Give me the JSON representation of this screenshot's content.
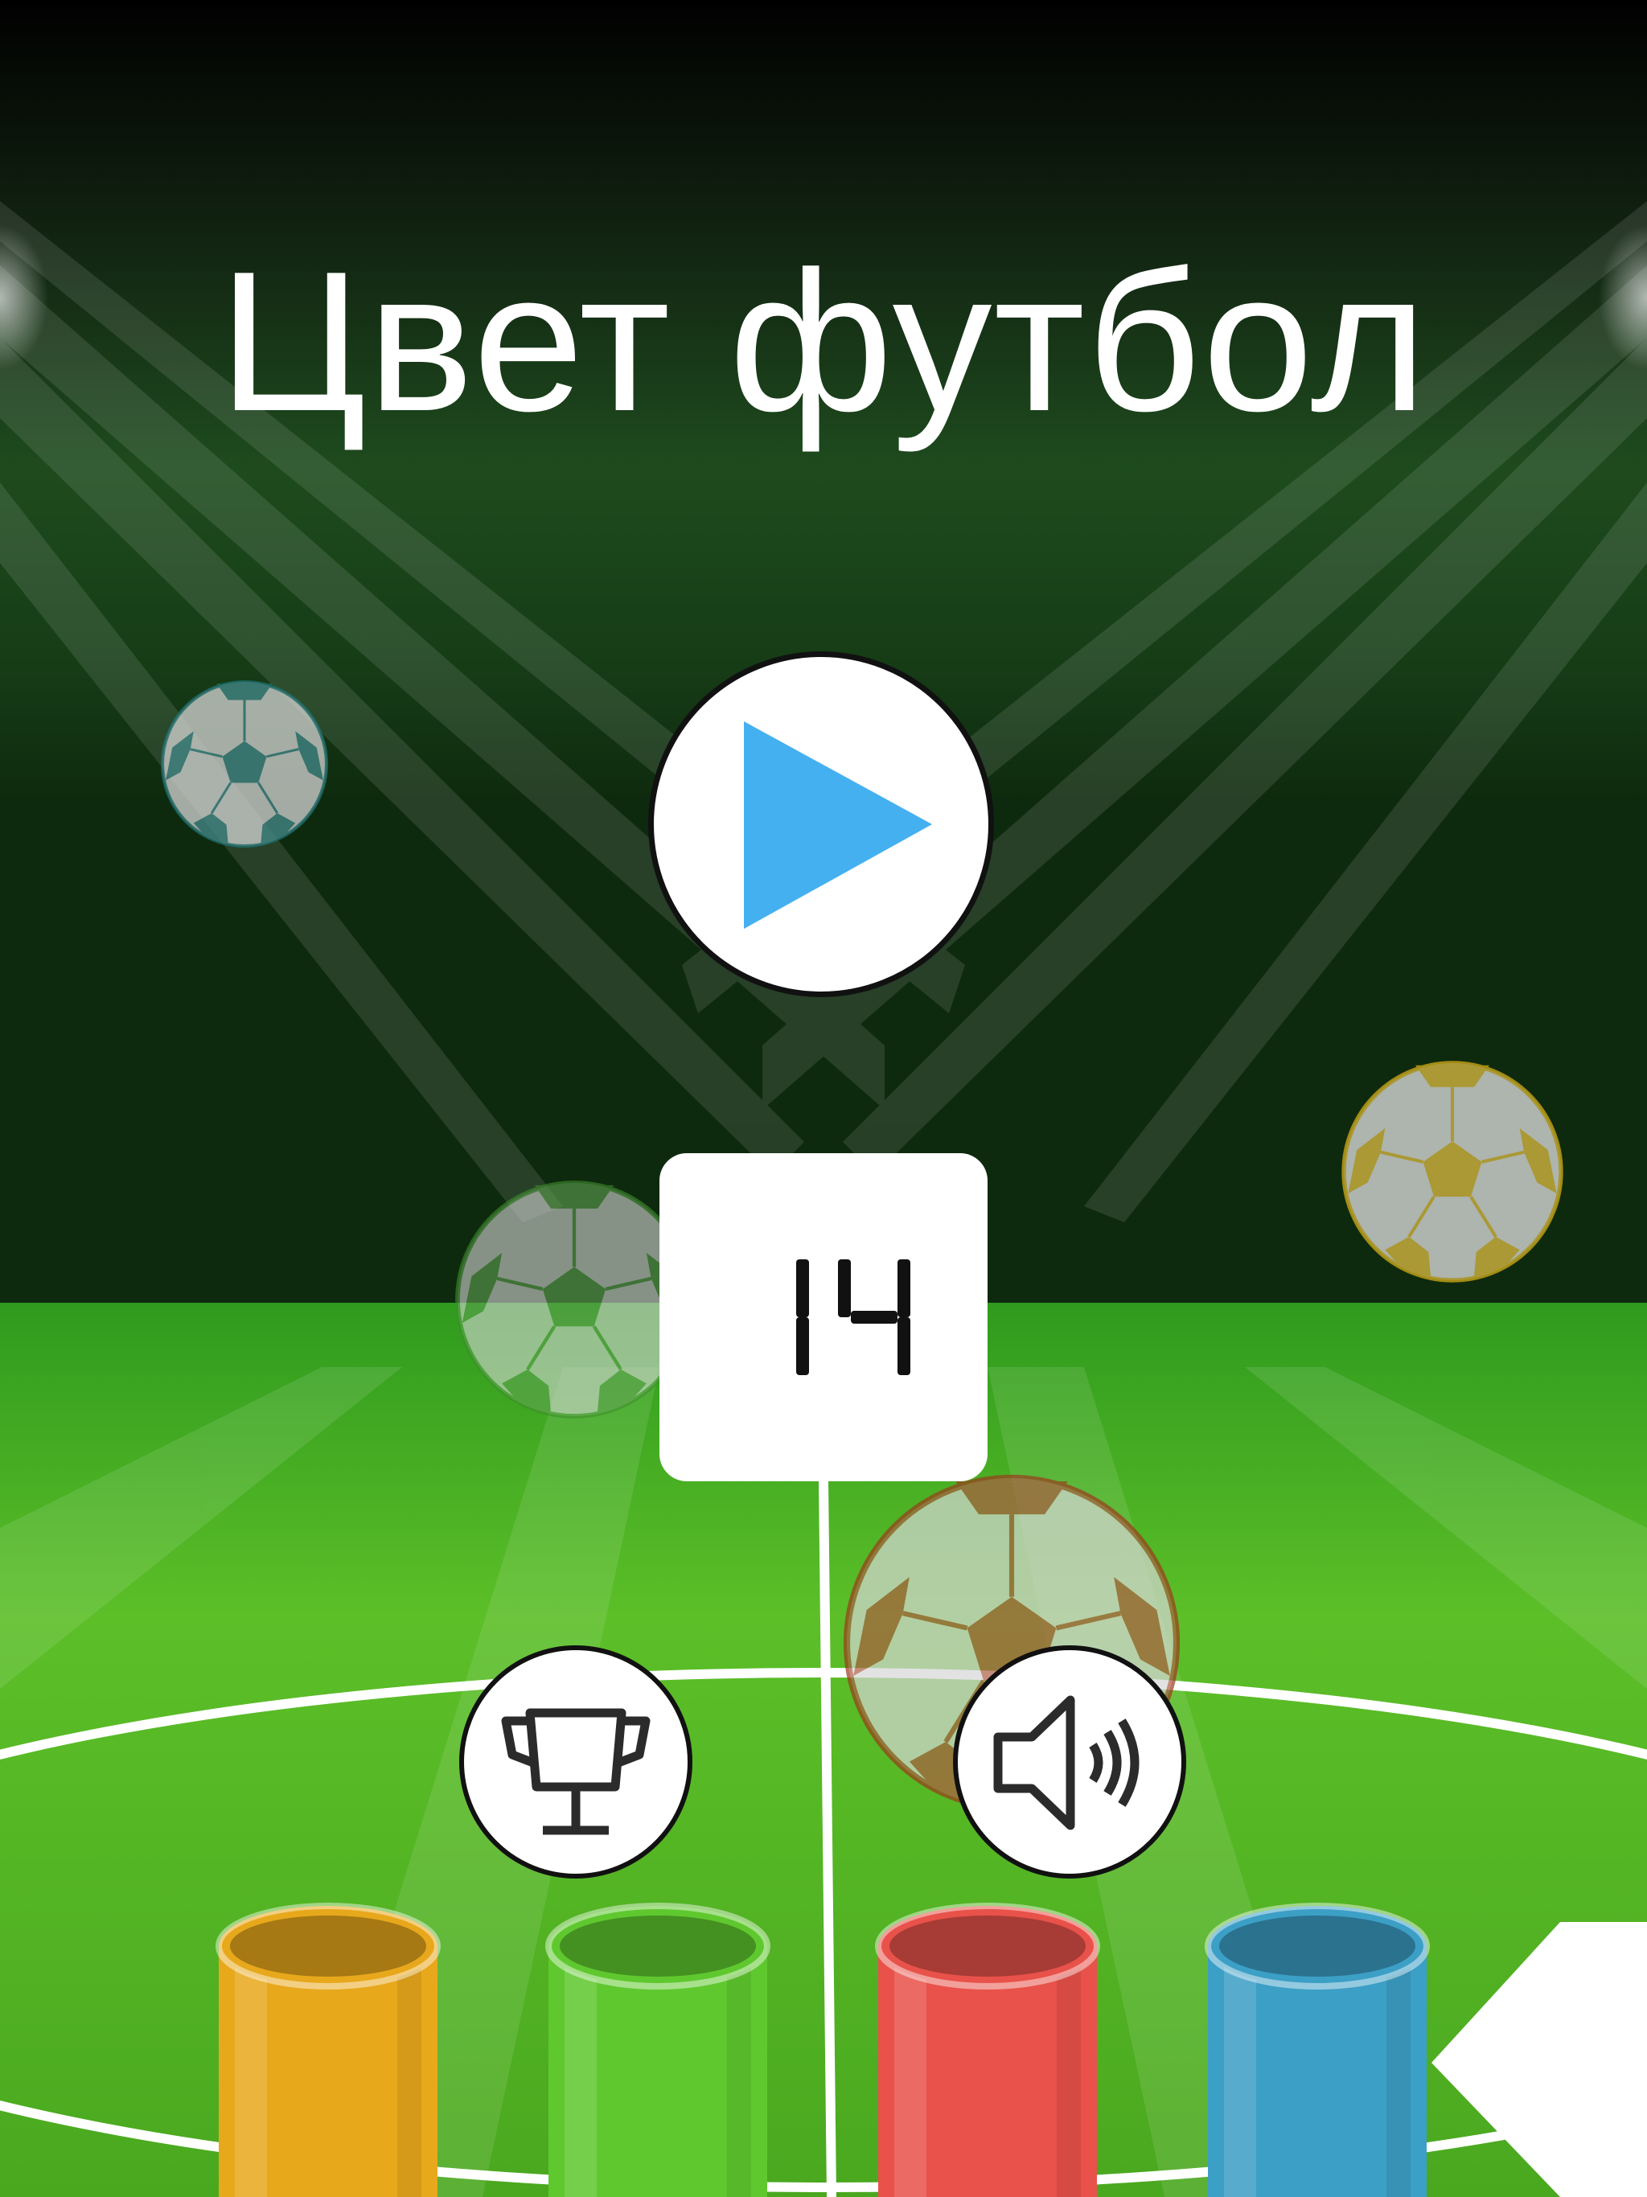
{
  "game": {
    "title": "Цвет футбол",
    "best_score": "14"
  },
  "buttons": {
    "play_icon": "play-icon",
    "leaderboard_icon": "trophy-icon",
    "sound_icon": "speaker-icon"
  },
  "colors": {
    "play_arrow": "#45B0F0",
    "tube_yellow": "#E8A81C",
    "tube_green": "#5FC82E",
    "tube_red": "#E8524A",
    "tube_blue": "#3C9FC6",
    "ball_teal": "#1E7275",
    "ball_green": "#3E8F2C",
    "ball_yellow": "#C9A514",
    "ball_red": "#9C3A1C"
  }
}
